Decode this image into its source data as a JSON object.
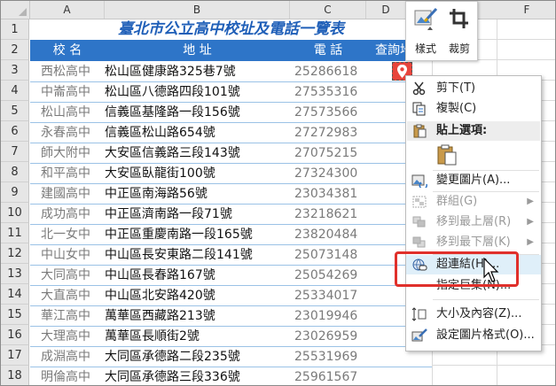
{
  "columns": [
    "A",
    "B",
    "C",
    "D",
    "F"
  ],
  "rows": [
    "1",
    "2",
    "3",
    "4",
    "5",
    "6",
    "7",
    "8",
    "9",
    "10",
    "11",
    "12",
    "13",
    "14",
    "15",
    "16",
    "17",
    "18"
  ],
  "sheet": {
    "title": "臺北市公立高中校址及電話一覽表",
    "headers": {
      "school": "校  名",
      "address": "地  址",
      "phone": "電  話",
      "query": "查詢地"
    },
    "records": [
      {
        "school": "西松高中",
        "address": "松山區健康路325巷7號",
        "phone": "25286618"
      },
      {
        "school": "中崙高中",
        "address": "松山區八德路四段101號",
        "phone": "27535316"
      },
      {
        "school": "松山高中",
        "address": "信義區基隆路一段156號",
        "phone": "27573566"
      },
      {
        "school": "永春高中",
        "address": "信義區松山路654號",
        "phone": "27272983"
      },
      {
        "school": "師大附中",
        "address": "大安區信義路三段143號",
        "phone": "27075215"
      },
      {
        "school": "和平高中",
        "address": "大安區臥龍街100號",
        "phone": "27324300"
      },
      {
        "school": "建國高中",
        "address": "中正區南海路56號",
        "phone": "23034381"
      },
      {
        "school": "成功高中",
        "address": "中正區濟南路一段71號",
        "phone": "23218621"
      },
      {
        "school": "北一女中",
        "address": "中正區重慶南路一段165號",
        "phone": "23820484"
      },
      {
        "school": "中山女中",
        "address": "中山區長安東路二段141號",
        "phone": "25073148"
      },
      {
        "school": "大同高中",
        "address": "中山區長春路167號",
        "phone": "25054269"
      },
      {
        "school": "大直高中",
        "address": "中山區北安路420號",
        "phone": "25334017"
      },
      {
        "school": "華江高中",
        "address": "萬華區西藏路213號",
        "phone": "23019946"
      },
      {
        "school": "大理高中",
        "address": "萬華區長順街2號",
        "phone": "23026959"
      },
      {
        "school": "成淵高中",
        "address": "大同區承德路二段235號",
        "phone": "25531969"
      },
      {
        "school": "明倫高中",
        "address": "大同區承德路三段336號",
        "phone": "25961567"
      }
    ]
  },
  "mini_toolbar": {
    "style_label": "樣式",
    "crop_label": "裁剪"
  },
  "context_menu": {
    "cut": "剪下(T)",
    "copy": "複製(C)",
    "paste_options": "貼上選項:",
    "change_picture": "變更圖片(A)...",
    "group": "群組(G)",
    "bring_front": "移到最上層(R)",
    "send_back": "移到最下層(K)",
    "hyperlink": "超連結(H)...",
    "assign_macro": "指定巨集(N)...",
    "size_props": "大小及內容(Z)...",
    "format_picture": "設定圖片格式(O)..."
  },
  "colors": {
    "header_blue": "#2e75c8",
    "title_blue": "#1f5fb8",
    "highlight": "#e0302b"
  }
}
